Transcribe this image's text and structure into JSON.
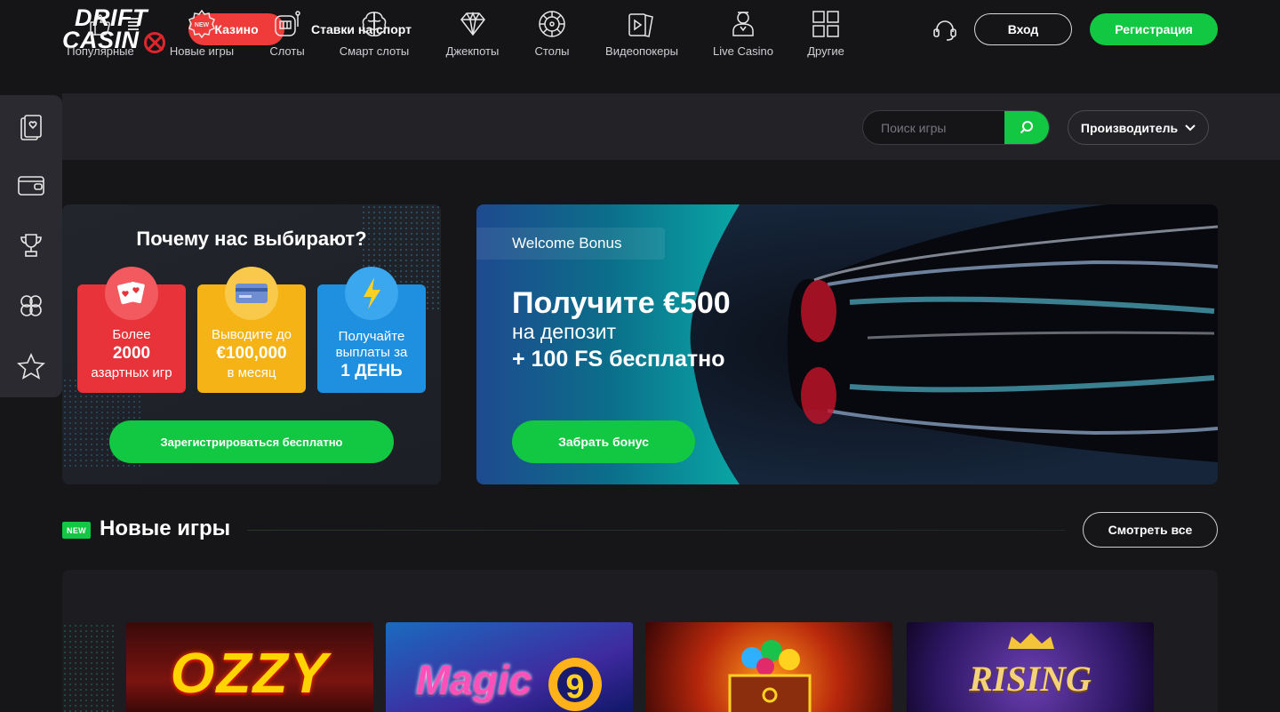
{
  "header": {
    "logo_line1": "DRIFT",
    "logo_line2": "CASIN",
    "casino_tab": "Казино",
    "sports_link": "Ставки на спорт",
    "login": "Вход",
    "register": "Регистрация"
  },
  "categories": [
    {
      "label": "Популярные",
      "icon": "thumbs-up-icon"
    },
    {
      "label": "Новые игры",
      "icon": "new-badge-icon"
    },
    {
      "label": "Слоты",
      "icon": "slot-machine-icon"
    },
    {
      "label": "Смарт слоты",
      "icon": "brain-icon"
    },
    {
      "label": "Джекпоты",
      "icon": "diamond-icon"
    },
    {
      "label": "Столы",
      "icon": "roulette-icon"
    },
    {
      "label": "Видеопокеры",
      "icon": "video-poker-icon"
    },
    {
      "label": "Live Casino",
      "icon": "dealer-icon"
    },
    {
      "label": "Другие",
      "icon": "grid-icon"
    }
  ],
  "search": {
    "placeholder": "Поиск игры"
  },
  "provider": {
    "label": "Производитель"
  },
  "rail": [
    "cards-icon",
    "wallet-icon",
    "trophy-icon",
    "clover-icon",
    "star-icon"
  ],
  "why": {
    "title": "Почему нас выбирают?",
    "cards": [
      {
        "l1": "Более",
        "l2": "2000",
        "l3": "азартных игр",
        "color": "#e8333a"
      },
      {
        "l1": "Выводите до",
        "l2": "€100,000",
        "l3": "в месяц",
        "color": "#f5b316"
      },
      {
        "l1": "Получайте выплаты за",
        "l2": "1 ДЕНЬ",
        "l3": "",
        "color": "#1f8fe0"
      }
    ],
    "cta": "Зарегистрироваться бесплатно"
  },
  "bonus": {
    "tag": "Welcome Bonus",
    "line1": "Получите €500",
    "line2": "на депозит",
    "line3": "+ 100 FS бесплатно",
    "cta": "Забрать бонус"
  },
  "new_games": {
    "badge": "NEW",
    "title": "Новые игры",
    "see_all": "Смотреть все",
    "tiles": [
      {
        "title": "OZZY"
      },
      {
        "title": "Magic"
      },
      {
        "title": ""
      },
      {
        "title": "RISING"
      }
    ]
  },
  "colors": {
    "accent": "#12c742",
    "casino": "#f03b3b",
    "bg": "#161619"
  }
}
